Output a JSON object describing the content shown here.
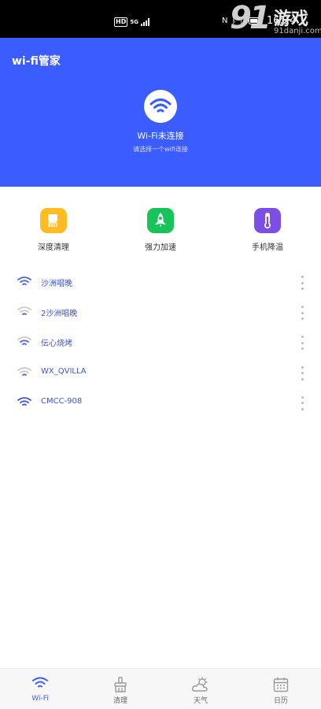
{
  "status_bar": {
    "hd_label": "HD",
    "net_label": "5G",
    "time": "16:24",
    "icons": [
      "nfc-icon",
      "bluetooth-icon",
      "vibrate-icon",
      "battery-icon"
    ]
  },
  "watermark": {
    "logo": "91",
    "text": "游戏",
    "url": "91danji.com"
  },
  "header": {
    "title": "wi-fi管家",
    "status": "Wi-Fi未连接",
    "hint": "请选择一个wifi连接",
    "bg_color": "#3b5cff"
  },
  "tools": [
    {
      "label": "深度清理",
      "icon": "broom-icon",
      "color": "#ffbb22"
    },
    {
      "label": "强力加速",
      "icon": "rocket-icon",
      "color": "#18c45a"
    },
    {
      "label": "手机降温",
      "icon": "thermometer-icon",
      "color": "#7b4fe6"
    }
  ],
  "wifi_list": [
    {
      "name": "沙洲唱晚",
      "signal": "strong"
    },
    {
      "name": "2沙洲唱晚",
      "signal": "weak"
    },
    {
      "name": "伝心烧烤",
      "signal": "medium"
    },
    {
      "name": "WX_QVILLA",
      "signal": "weak"
    },
    {
      "name": "CMCC-908",
      "signal": "strong"
    }
  ],
  "tabs": [
    {
      "label": "Wi-Fi",
      "icon": "wifi-icon",
      "active": true
    },
    {
      "label": "清理",
      "icon": "broom-icon",
      "active": false
    },
    {
      "label": "天气",
      "icon": "weather-icon",
      "active": false
    },
    {
      "label": "日历",
      "icon": "calendar-icon",
      "active": false
    }
  ]
}
